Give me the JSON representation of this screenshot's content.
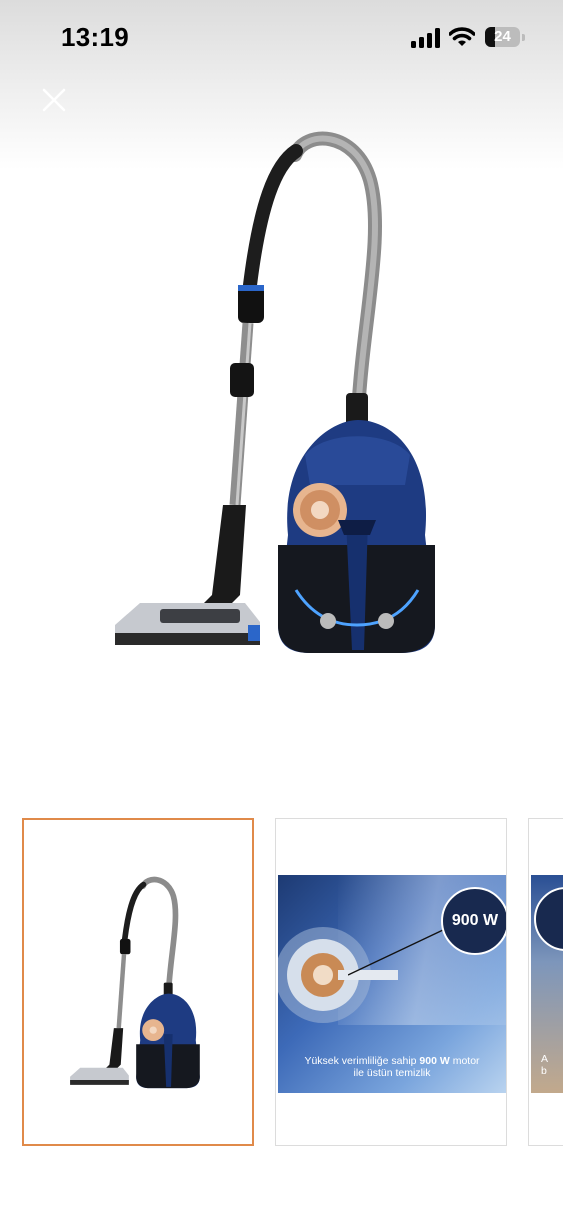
{
  "status_bar": {
    "time": "13:19",
    "battery_level": "24"
  },
  "header": {
    "close_icon": "close-icon"
  },
  "gallery": {
    "main_image": "vacuum-cleaner-image",
    "thumbnails": [
      {
        "id": "thumb-1",
        "selected": true,
        "image": "vacuum-cleaner-image"
      },
      {
        "id": "thumb-2",
        "selected": false,
        "badge": "900 W",
        "caption_prefix": "Yüksek verimliliğe sahip ",
        "caption_bold": "900 W",
        "caption_suffix": " motor",
        "caption_line2": "ile üstün temizlik"
      },
      {
        "id": "thumb-3",
        "selected": false,
        "caption_fragment_1": "A",
        "caption_fragment_2": "b"
      }
    ]
  },
  "colors": {
    "selected_border": "#e08a4a",
    "body_blue": "#1e3b82",
    "badge_navy": "#18294f"
  }
}
